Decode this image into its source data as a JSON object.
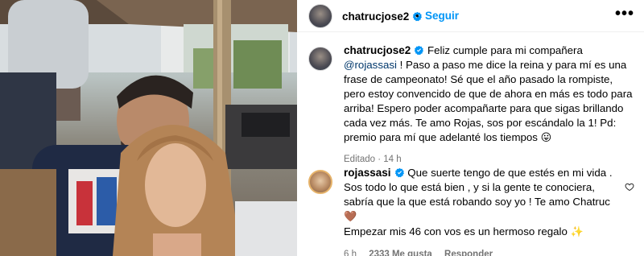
{
  "header": {
    "username": "chatrucjose2",
    "dot": "•",
    "follow_label": "Seguir",
    "more_label": "•••"
  },
  "post": {
    "username": "chatrucjose2",
    "text_before_mention": "Feliz cumple para mi compañera ",
    "mention": "@rojassasi",
    "text_after_mention": " ! Paso a paso me dice la reina y para mí es una frase de campeonato! Sé que el año pasado la rompiste, pero estoy convencido de que de ahora en más es todo para arriba! Espero poder acompañarte para que sigas brillando cada vez más. Te amo Rojas, sos por escándalo la 1! Pd: premio para mí que adelanté los tiempos",
    "emoji": "😛",
    "edited_label": "Editado",
    "edited_sep": "·",
    "edited_time": "14 h"
  },
  "comment": {
    "username": "rojassasi",
    "text": "Que suerte tengo de que estés en mi vida . Sos todo lo que está bien , y si la gente te conociera, sabría que la que está robando soy yo ! Te amo Chatruc",
    "emoji_1": "🤎",
    "text_2": "Empezar mis 46 con vos es un hermoso regalo",
    "emoji_2": "✨",
    "time": "6 h",
    "likes": "2333 Me gusta",
    "reply_label": "Responder"
  },
  "colors": {
    "link_blue": "#0095f6",
    "mention_blue": "#00376b",
    "meta_gray": "#737373",
    "verified_blue": "#0095f6"
  },
  "icons": [
    "verified-badge-icon",
    "more-options-icon",
    "heart-icon"
  ]
}
